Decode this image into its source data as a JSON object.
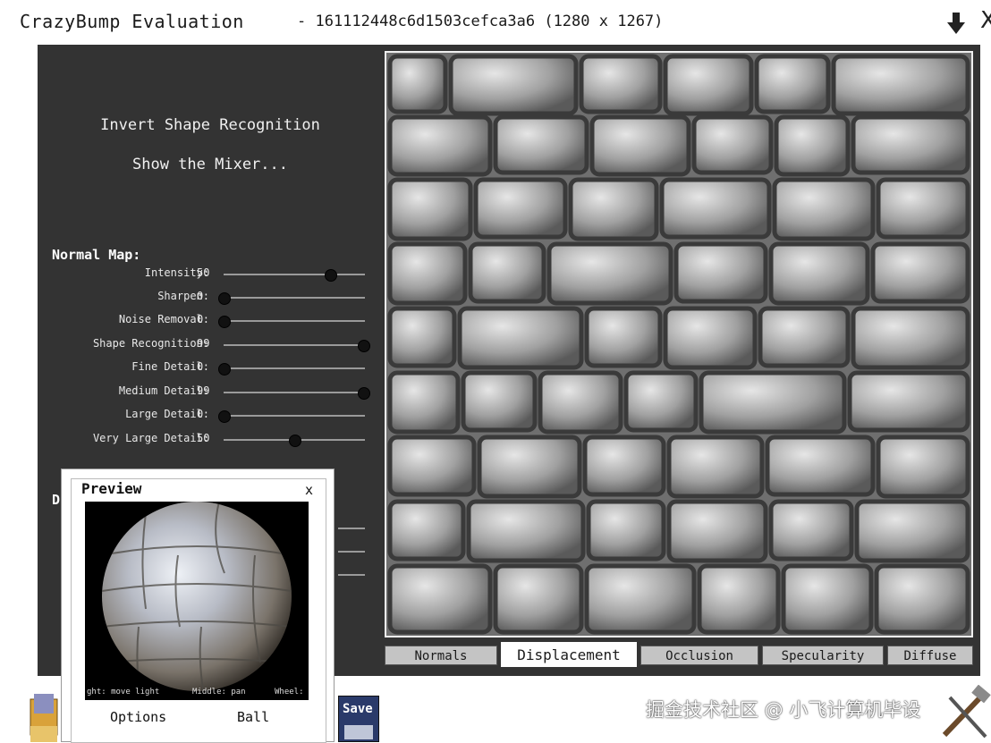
{
  "window": {
    "app_title": "CrazyBump Evaluation",
    "file_title": "- 161112448c6d1503cefca3a6 (1280 x 1267)",
    "close_glyph": "X",
    "download_icon": "download-arrow-icon"
  },
  "menu": {
    "invert": "Invert Shape Recognition",
    "mixer": "Show the Mixer..."
  },
  "normal_map": {
    "label": "Normal Map:",
    "sliders": [
      {
        "label": "Intensity:",
        "value": "50",
        "level": 0.75
      },
      {
        "label": "Sharpen:",
        "value": "0",
        "level": 0.0
      },
      {
        "label": "Noise Removal:",
        "value": "0",
        "level": 0.0
      },
      {
        "label": "Shape Recognition:",
        "value": "99",
        "level": 0.99
      },
      {
        "label": "Fine Detail:",
        "value": "0",
        "level": 0.0
      },
      {
        "label": "Medium Detail:",
        "value": "99",
        "level": 0.99
      },
      {
        "label": "Large Detail:",
        "value": "0",
        "level": 0.0
      },
      {
        "label": "Very Large Detail:",
        "value": "50",
        "level": 0.5
      }
    ]
  },
  "hidden_section_initial": "D",
  "tabs": [
    {
      "label": "Normals",
      "active": false
    },
    {
      "label": "Displacement",
      "active": true
    },
    {
      "label": "Occlusion",
      "active": false
    },
    {
      "label": "Specularity",
      "active": false
    },
    {
      "label": "Diffuse",
      "active": false
    }
  ],
  "preview": {
    "title": "Preview",
    "close": "x",
    "hints": [
      "ght: move light",
      "Middle: pan",
      "Wheel:"
    ],
    "options_label": "Options",
    "shape_label": "Ball"
  },
  "bottom": {
    "save_label": "Save",
    "open_icon": "open-folder-icon",
    "tools_icon": "tools-icon",
    "watermark": "掘金技术社区 @ 小飞计算机毕设"
  },
  "colors": {
    "panel": "#333333",
    "tab_inactive": "#c4c4c4",
    "tab_active": "#ffffff"
  }
}
